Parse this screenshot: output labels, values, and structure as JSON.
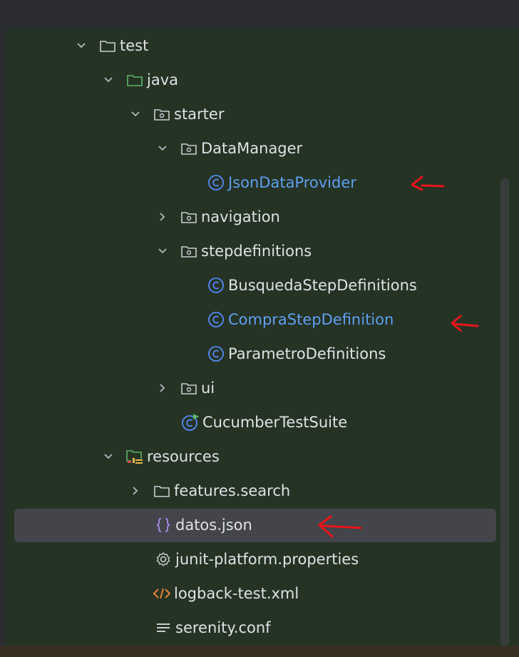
{
  "project_tree": {
    "items": [
      {
        "label": "test",
        "icon": "folder-icon",
        "chevron": "down"
      },
      {
        "label": "java",
        "icon": "source-folder-icon",
        "chevron": "down"
      },
      {
        "label": "starter",
        "icon": "package-icon",
        "chevron": "down"
      },
      {
        "label": "DataManager",
        "icon": "package-icon",
        "chevron": "down"
      },
      {
        "label": "JsonDataProvider",
        "icon": "class-icon",
        "chevron": "none"
      },
      {
        "label": "navigation",
        "icon": "package-icon",
        "chevron": "right"
      },
      {
        "label": "stepdefinitions",
        "icon": "package-icon",
        "chevron": "down"
      },
      {
        "label": "BusquedaStepDefinitions",
        "icon": "class-icon",
        "chevron": "none"
      },
      {
        "label": "CompraStepDefinition",
        "icon": "class-icon",
        "chevron": "none"
      },
      {
        "label": "ParametroDefinitions",
        "icon": "class-icon",
        "chevron": "none"
      },
      {
        "label": "ui",
        "icon": "package-icon",
        "chevron": "right"
      },
      {
        "label": "CucumberTestSuite",
        "icon": "runnable-class-icon",
        "chevron": "none"
      },
      {
        "label": "resources",
        "icon": "resources-folder-icon",
        "chevron": "down"
      },
      {
        "label": "features.search",
        "icon": "folder-icon",
        "chevron": "right"
      },
      {
        "label": "datos.json",
        "icon": "json-file-icon",
        "chevron": "none",
        "selected": true
      },
      {
        "label": "junit-platform.properties",
        "icon": "properties-file-icon",
        "chevron": "none"
      },
      {
        "label": "logback-test.xml",
        "icon": "xml-file-icon",
        "chevron": "none"
      },
      {
        "label": "serenity.conf",
        "icon": "text-file-icon",
        "chevron": "none"
      }
    ]
  },
  "annotations": {
    "arrow_color": "#e8141b",
    "arrows": [
      "arrow-json-data-provider",
      "arrow-compra-step",
      "arrow-datos-json"
    ]
  },
  "colors": {
    "panel_bg": "#253325",
    "selected_bg": "#43454a",
    "text": "#dfe1e5",
    "blue_text": "#5f9ff0",
    "class_icon": "#548af7"
  }
}
